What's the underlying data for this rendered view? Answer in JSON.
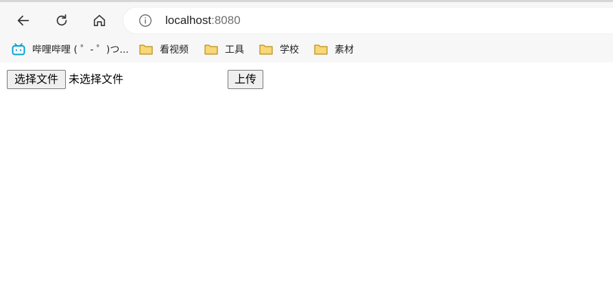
{
  "browser": {
    "url_host": "localhost",
    "url_port": ":8080",
    "nav_icons": [
      "back-arrow-icon",
      "reload-icon",
      "home-icon",
      "info-icon"
    ]
  },
  "bookmarks": [
    {
      "label": "哔哩哔哩 ( ゜- ゜)つ...",
      "icon": "bilibili-icon"
    },
    {
      "label": "看视频",
      "icon": "folder-icon"
    },
    {
      "label": "工具",
      "icon": "folder-icon"
    },
    {
      "label": "学校",
      "icon": "folder-icon"
    },
    {
      "label": "素材",
      "icon": "folder-icon"
    }
  ],
  "form": {
    "choose_file_label": "选择文件",
    "file_status": "未选择文件",
    "upload_label": "上传"
  },
  "colors": {
    "bilibili": "#00a1d6",
    "folder_fill": "#f8d775",
    "folder_stroke": "#b88a17"
  }
}
